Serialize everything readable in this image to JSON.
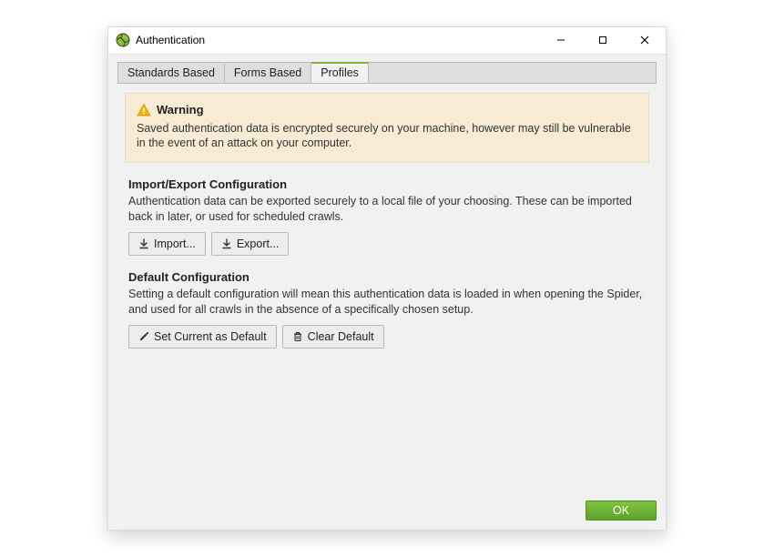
{
  "title": "Authentication",
  "window_controls": {
    "minimize": "–",
    "maximize": "☐",
    "close": "✕"
  },
  "tabs": [
    {
      "label": "Standards Based",
      "active": false
    },
    {
      "label": "Forms Based",
      "active": false
    },
    {
      "label": "Profiles",
      "active": true
    }
  ],
  "warning": {
    "heading": "Warning",
    "body": "Saved authentication data is encrypted securely on your machine, however may still be vulnerable in the event of an attack on your computer."
  },
  "sections": {
    "import_export": {
      "title": "Import/Export Configuration",
      "desc": "Authentication data can be exported securely to a local file of your choosing. These can be imported back in later, or used for scheduled crawls.",
      "buttons": {
        "import": "Import...",
        "export": "Export..."
      }
    },
    "default_config": {
      "title": "Default Configuration",
      "desc": "Setting a default configuration will mean this authentication data is loaded in when opening the Spider, and used for all crawls in the absence of a specifically chosen setup.",
      "buttons": {
        "set_default": "Set Current as Default",
        "clear_default": "Clear Default"
      }
    }
  },
  "footer": {
    "ok": "OK"
  },
  "colors": {
    "accent_green": "#6fb531",
    "warning_bg": "#f7ecd3",
    "warning_border": "#e6dcc0",
    "tab_active_border": "#7db43a"
  }
}
